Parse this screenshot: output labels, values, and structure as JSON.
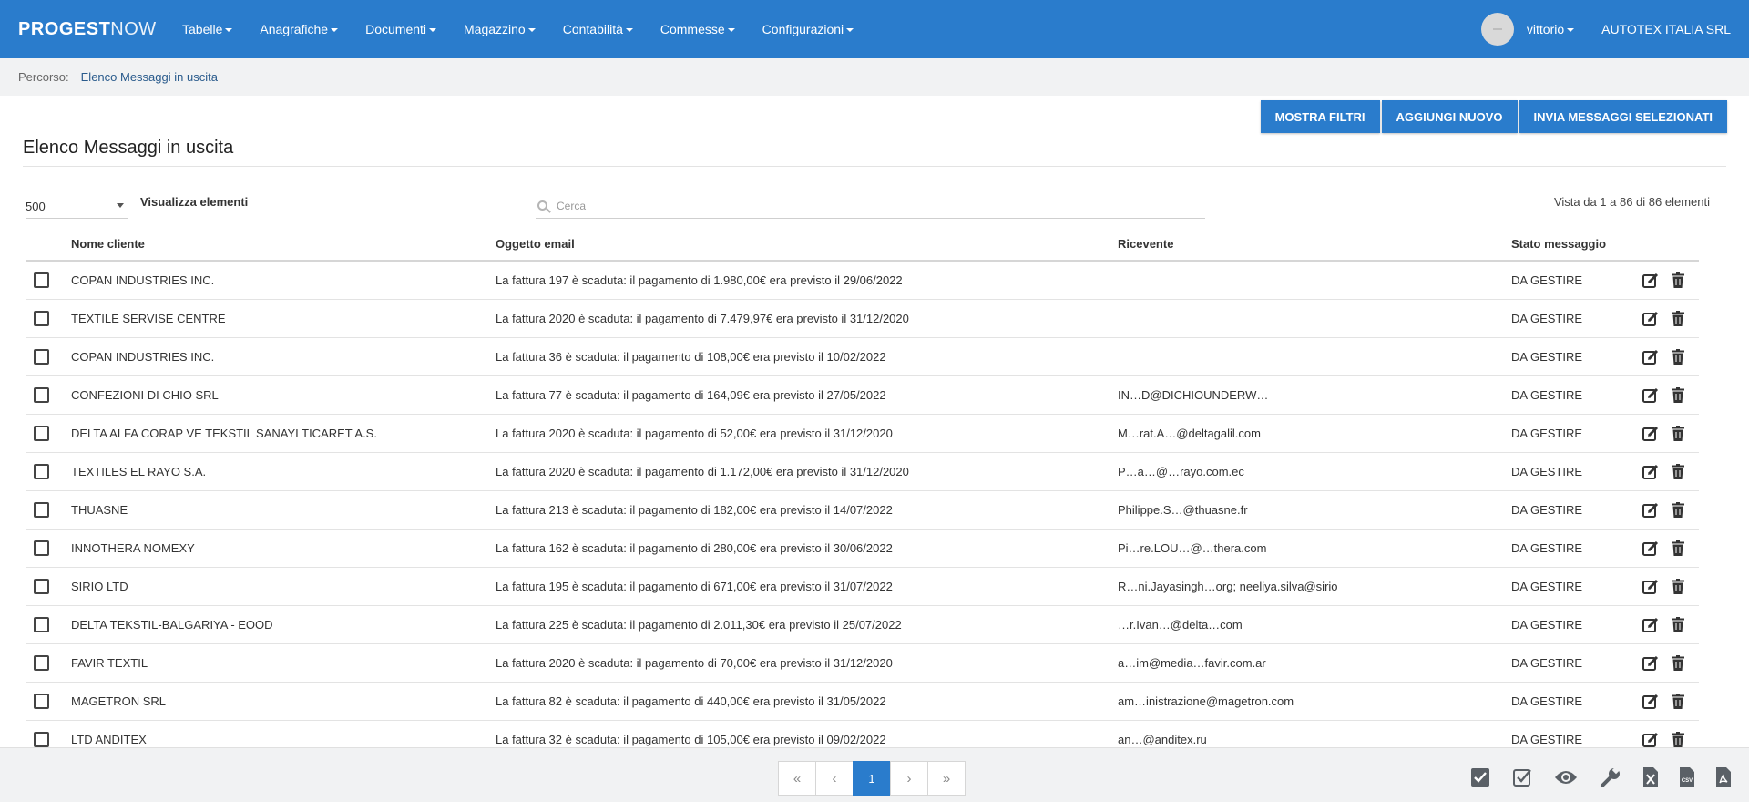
{
  "navbar": {
    "brand_bold": "PROGEST",
    "brand_light": "NOW",
    "menu": [
      {
        "label": "Tabelle"
      },
      {
        "label": "Anagrafiche"
      },
      {
        "label": "Documenti"
      },
      {
        "label": "Magazzino"
      },
      {
        "label": "Contabilità"
      },
      {
        "label": "Commesse"
      },
      {
        "label": "Configurazioni"
      }
    ],
    "user": "vittorio",
    "company": "AUTOTEX ITALIA SRL"
  },
  "breadcrumb": {
    "label": "Percorso:",
    "current": "Elenco Messaggi in uscita"
  },
  "actions": {
    "filters": "MOSTRA FILTRI",
    "add": "AGGIUNGI NUOVO",
    "send": "INVIA MESSAGGI SELEZIONATI"
  },
  "page": {
    "title": "Elenco Messaggi in uscita",
    "page_size": "500",
    "show_label": "Visualizza elementi",
    "search_placeholder": "Cerca",
    "info": "Vista da 1 a 86 di 86 elementi"
  },
  "table": {
    "headers": {
      "name": "Nome cliente",
      "subject": "Oggetto email",
      "recipient": "Ricevente",
      "status": "Stato messaggio"
    },
    "rows": [
      {
        "name": "COPAN INDUSTRIES INC.",
        "subject": "La fattura 197 è scaduta: il pagamento di 1.980,00€ era previsto il 29/06/2022",
        "recipient": "",
        "status": "DA GESTIRE"
      },
      {
        "name": "TEXTILE SERVISE CENTRE",
        "subject": "La fattura 2020 è scaduta: il pagamento di 7.479,97€ era previsto il 31/12/2020",
        "recipient": "",
        "status": "DA GESTIRE"
      },
      {
        "name": "COPAN INDUSTRIES INC.",
        "subject": "La fattura 36 è scaduta: il pagamento di 108,00€ era previsto il 10/02/2022",
        "recipient": "",
        "status": "DA GESTIRE"
      },
      {
        "name": "CONFEZIONI DI CHIO SRL",
        "subject": "La fattura 77 è scaduta: il pagamento di 164,09€ era previsto il 27/05/2022",
        "recipient": "IN…D@DICHIOUNDERW…",
        "status": "DA GESTIRE"
      },
      {
        "name": "DELTA ALFA CORAP VE TEKSTIL SANAYI TICARET A.S.",
        "subject": "La fattura 2020 è scaduta: il pagamento di 52,00€ era previsto il 31/12/2020",
        "recipient": "M…rat.A…@deltagalil.com",
        "status": "DA GESTIRE"
      },
      {
        "name": "TEXTILES EL RAYO S.A.",
        "subject": "La fattura 2020 è scaduta: il pagamento di 1.172,00€ era previsto il 31/12/2020",
        "recipient": "P…a…@…rayo.com.ec",
        "status": "DA GESTIRE"
      },
      {
        "name": "THUASNE",
        "subject": "La fattura 213 è scaduta: il pagamento di 182,00€ era previsto il 14/07/2022",
        "recipient": "Philippe.S…@thuasne.fr",
        "status": "DA GESTIRE"
      },
      {
        "name": "INNOTHERA NOMEXY",
        "subject": "La fattura 162 è scaduta: il pagamento di 280,00€ era previsto il 30/06/2022",
        "recipient": "Pi…re.LOU…@…thera.com",
        "status": "DA GESTIRE"
      },
      {
        "name": "SIRIO LTD",
        "subject": "La fattura 195 è scaduta: il pagamento di 671,00€ era previsto il 31/07/2022",
        "recipient": "R…ni.Jayasingh…org; neeliya.silva@sirio",
        "status": "DA GESTIRE"
      },
      {
        "name": "DELTA TEKSTIL-BALGARIYA - EOOD",
        "subject": "La fattura 225 è scaduta: il pagamento di 2.011,30€ era previsto il 25/07/2022",
        "recipient": "…r.Ivan…@delta…com",
        "status": "DA GESTIRE"
      },
      {
        "name": "FAVIR TEXTIL",
        "subject": "La fattura 2020 è scaduta: il pagamento di 70,00€ era previsto il 31/12/2020",
        "recipient": "a…im@media…favir.com.ar",
        "status": "DA GESTIRE"
      },
      {
        "name": "MAGETRON SRL",
        "subject": "La fattura 82 è scaduta: il pagamento di 440,00€ era previsto il 31/05/2022",
        "recipient": "am…inistrazione@magetron.com",
        "status": "DA GESTIRE"
      },
      {
        "name": "LTD ANDITEX",
        "subject": "La fattura 32 è scaduta: il pagamento di 105,00€ era previsto il 09/02/2022",
        "recipient": "an…@anditex.ru",
        "status": "DA GESTIRE"
      }
    ]
  },
  "pagination": {
    "first": "«",
    "prev": "‹",
    "current": "1",
    "next": "›",
    "last": "»"
  },
  "footer_tools": {
    "icons": [
      "select-all-icon",
      "deselect-icon",
      "eye-icon",
      "wrench-icon",
      "excel-icon",
      "csv-icon",
      "pdf-icon"
    ],
    "csv_label": "CSV"
  },
  "colors": {
    "primary": "#2a7ccc",
    "breadcrumb_bg": "#f1f2f3"
  }
}
